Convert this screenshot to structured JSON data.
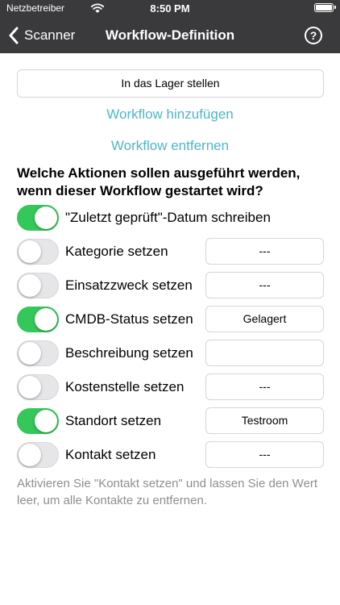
{
  "status_bar": {
    "carrier": "Netzbetreiber",
    "time": "8:50 PM"
  },
  "nav": {
    "back_label": "Scanner",
    "title": "Workflow-Definition",
    "help_symbol": "?"
  },
  "workflow": {
    "selected": "In das Lager stellen",
    "add_label": "Workflow hinzufügen",
    "remove_label": "Workflow entfernen"
  },
  "question": "Welche Aktionen sollen ausgeführt werden, wenn dieser Workflow gestartet wird?",
  "actions": [
    {
      "label": "\"Zuletzt geprüft\"-Datum schreiben",
      "enabled": true
    },
    {
      "label": "Kategorie setzen",
      "enabled": false,
      "value": "---"
    },
    {
      "label": "Einsatzzweck setzen",
      "enabled": false,
      "value": "---"
    },
    {
      "label": "CMDB-Status setzen",
      "enabled": true,
      "value": "Gelagert"
    },
    {
      "label": "Beschreibung setzen",
      "enabled": false,
      "value": ""
    },
    {
      "label": "Kostenstelle setzen",
      "enabled": false,
      "value": "---"
    },
    {
      "label": "Standort setzen",
      "enabled": true,
      "value": "Testroom"
    },
    {
      "label": "Kontakt setzen",
      "enabled": false,
      "value": "---"
    }
  ],
  "footnote": "Aktivieren Sie \"Kontakt setzen\" und lassen Sie den Wert leer, um alle Kontakte zu entfernen.",
  "colors": {
    "nav_bg": "#3a3a3c",
    "accent": "#4fb6c6",
    "switch_on": "#34c759",
    "switch_off": "#e6e6e9"
  }
}
